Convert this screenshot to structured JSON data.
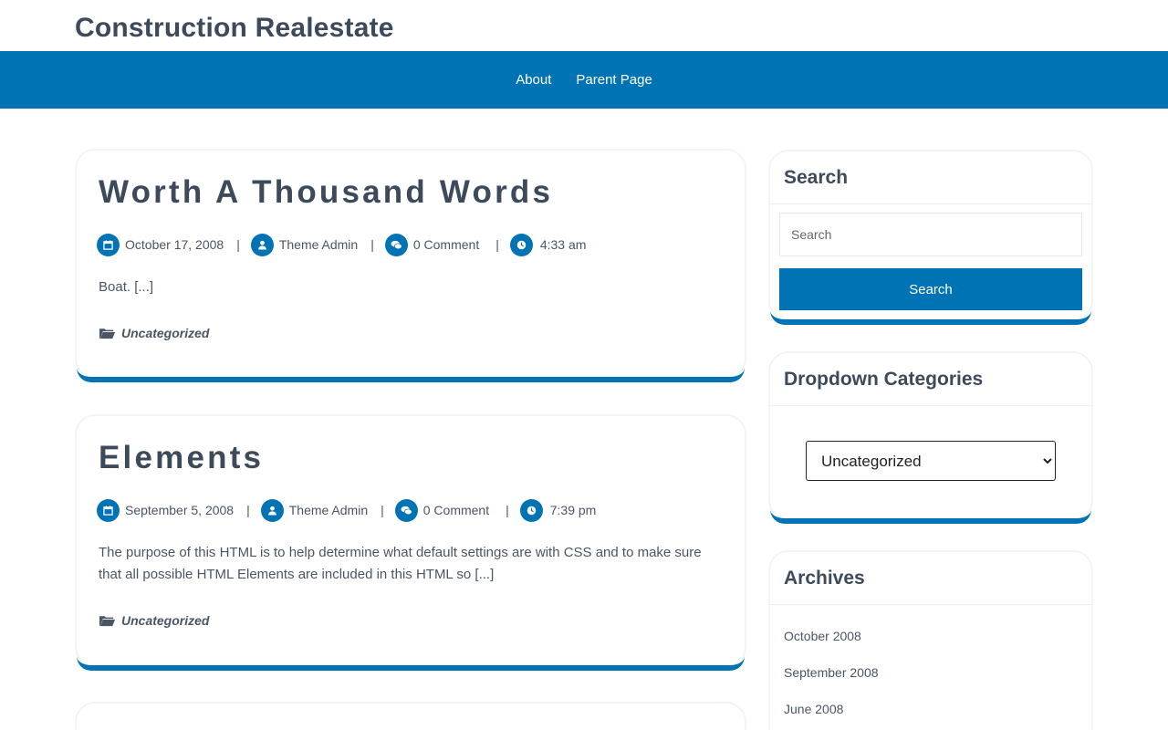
{
  "site": {
    "title": "Construction Realestate"
  },
  "nav": {
    "items": [
      {
        "label": "About"
      },
      {
        "label": "Parent Page"
      }
    ]
  },
  "posts": [
    {
      "title": "Worth A Thousand Words",
      "date": "October 17, 2008",
      "author": "Theme Admin",
      "comments": "0 Comment",
      "time": "4:33 am",
      "excerpt": "Boat. [...]",
      "category": "Uncategorized"
    },
    {
      "title": "Elements",
      "date": "September 5, 2008",
      "author": "Theme Admin",
      "comments": "0 Comment",
      "time": "7:39 pm",
      "excerpt": "The purpose of this HTML is to help determine what default settings are with CSS and to make sure that all possible HTML Elements are included in this HTML so [...]",
      "category": "Uncategorized"
    }
  ],
  "meta_separator": "|",
  "sidebar": {
    "search": {
      "title": "Search",
      "placeholder": "Search",
      "button_label": "Search"
    },
    "categories": {
      "title": "Dropdown Categories",
      "selected": "Uncategorized"
    },
    "archives": {
      "title": "Archives",
      "items": [
        "October 2008",
        "September 2008",
        "June 2008"
      ]
    }
  },
  "icons": {
    "date": "calendar-icon",
    "author": "user-icon",
    "comments": "comments-icon",
    "time": "clock-icon",
    "category": "folder-icon"
  },
  "colors": {
    "accent": "#0073b5",
    "text": "#3d4a5c",
    "background": "#ffffff"
  }
}
